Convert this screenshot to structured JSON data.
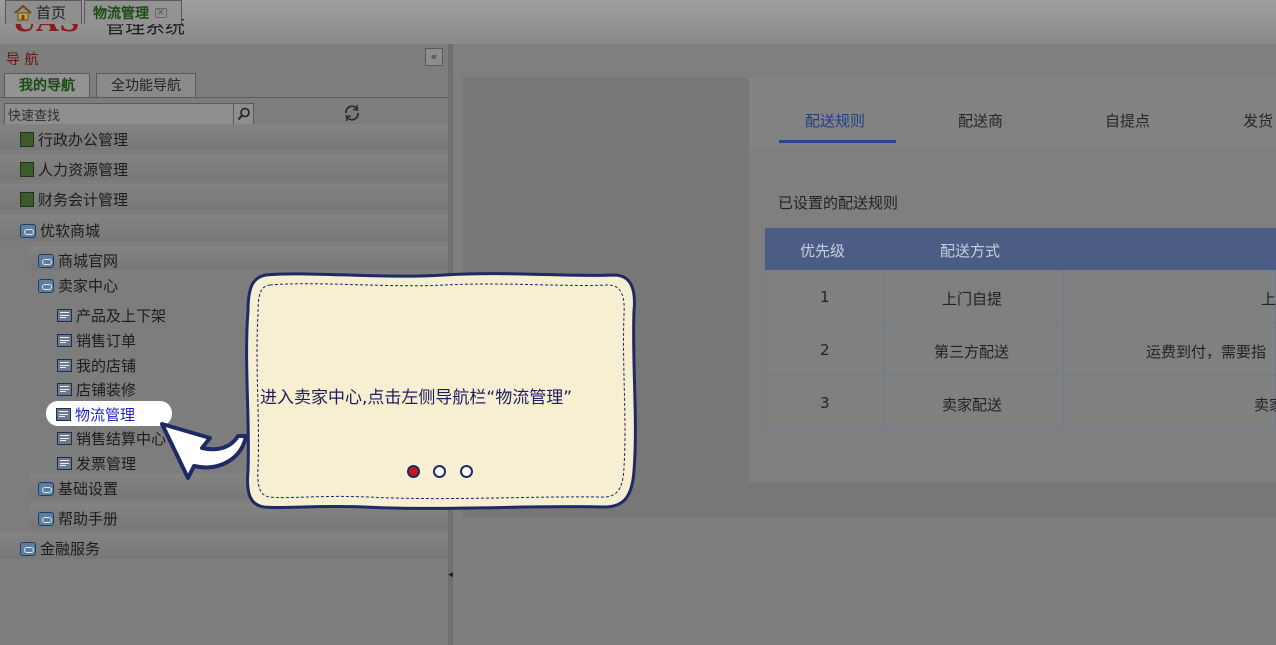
{
  "header": {
    "logo": "UAS",
    "title": "管理系统"
  },
  "sidebar": {
    "title": "导 航",
    "collapse": "«",
    "tabs": [
      "我的导航",
      "全功能导航"
    ],
    "search_placeholder": "快速查找",
    "items": [
      {
        "label": "行政办公管理",
        "icon": "book-icon"
      },
      {
        "label": "人力资源管理",
        "icon": "book-icon"
      },
      {
        "label": "财务会计管理",
        "icon": "book-icon"
      },
      {
        "label": "优软商城",
        "icon": "cloud-folder-icon"
      },
      {
        "label": "商城官网",
        "icon": "cloud-folder-icon"
      },
      {
        "label": "卖家中心",
        "icon": "cloud-folder-icon"
      },
      {
        "label": "产品及上下架",
        "icon": "list-icon"
      },
      {
        "label": "销售订单",
        "icon": "list-icon"
      },
      {
        "label": "我的店铺",
        "icon": "list-icon"
      },
      {
        "label": "店铺装修",
        "icon": "list-icon"
      },
      {
        "label": "物流管理",
        "icon": "list-icon"
      },
      {
        "label": "销售结算中心",
        "icon": "list-icon"
      },
      {
        "label": "发票管理",
        "icon": "list-icon"
      },
      {
        "label": "基础设置",
        "icon": "cloud-folder-icon"
      },
      {
        "label": "帮助手册",
        "icon": "cloud-folder-icon"
      },
      {
        "label": "金融服务",
        "icon": "cloud-folder-icon"
      }
    ]
  },
  "page_tabs": {
    "home": "首页",
    "logistics": "物流管理"
  },
  "content": {
    "subtabs": [
      "配送规则",
      "配送商",
      "自提点",
      "发货"
    ],
    "section_title": "已设置的配送规则",
    "table": {
      "headers": [
        "优先级",
        "配送方式"
      ],
      "rows": [
        {
          "priority": "1",
          "method": "上门自提",
          "extra": "上"
        },
        {
          "priority": "2",
          "method": "第三方配送",
          "extra": "运费到付，需要指"
        },
        {
          "priority": "3",
          "method": "卖家配送",
          "extra": "卖家"
        }
      ]
    }
  },
  "tooltip": {
    "text": "进入卖家中心,点击左侧导航栏“物流管理”",
    "page_count": 3,
    "current_page": 1
  },
  "colors": {
    "brand": "#8a1c1c",
    "accent": "#2a468a",
    "tooltip_bg": "#f7efd2",
    "tooltip_border": "#1e2a66",
    "active_dot": "#c51818"
  }
}
